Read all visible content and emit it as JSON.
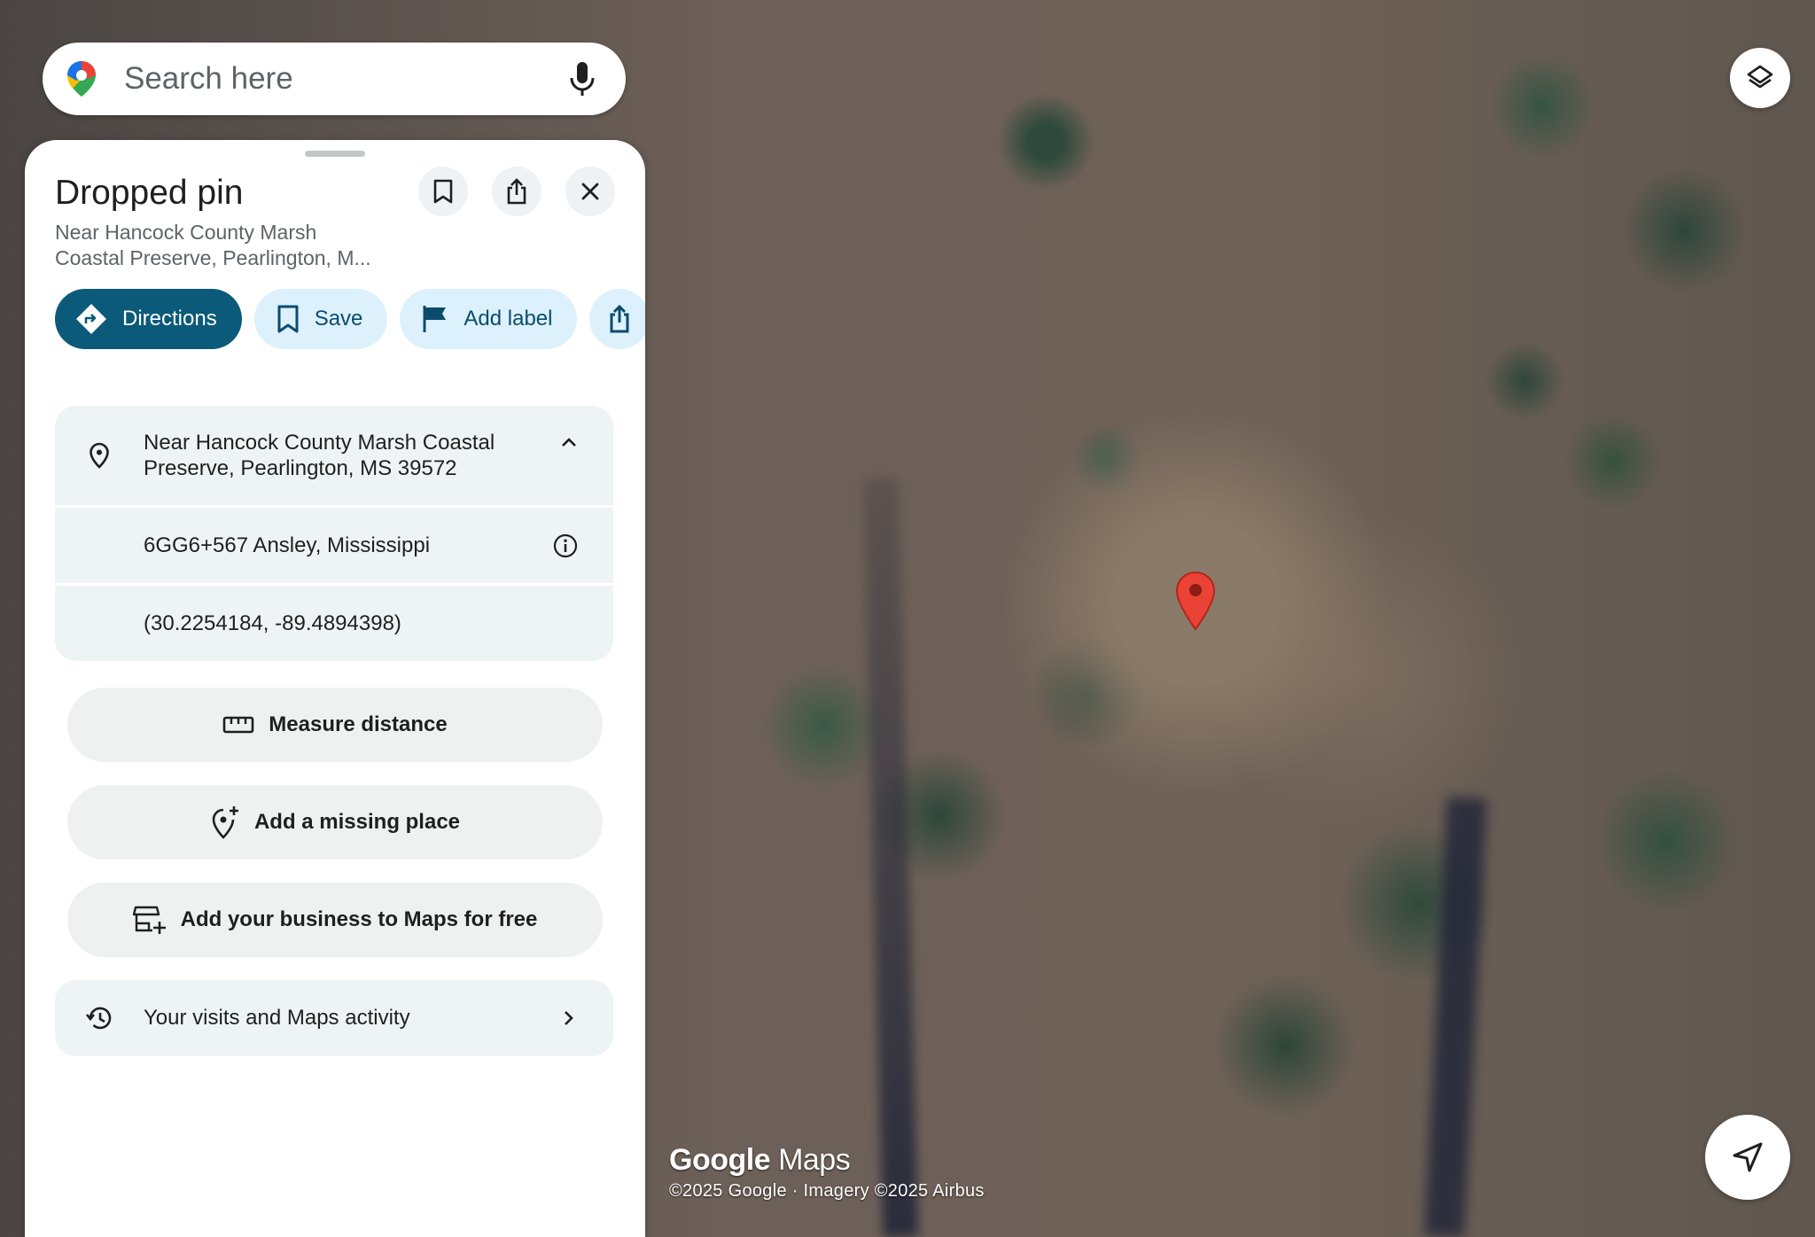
{
  "search": {
    "placeholder": "Search here"
  },
  "place": {
    "title": "Dropped pin",
    "subtitle_line1": "Near Hancock County Marsh",
    "subtitle_line2": "Coastal Preserve, Pearlington, M..."
  },
  "chips": {
    "directions": "Directions",
    "save": "Save",
    "add_label": "Add label"
  },
  "details": {
    "address_line1": "Near Hancock County Marsh Coastal",
    "address_line2": "Preserve, Pearlington, MS 39572",
    "plus_code": "6GG6+567 Ansley, Mississippi",
    "coordinates": "(30.2254184, -89.4894398)"
  },
  "actions": {
    "measure": "Measure distance",
    "missing_place": "Add a missing place",
    "business": "Add your business to Maps for free"
  },
  "visits": {
    "label": "Your visits and Maps activity"
  },
  "attribution": {
    "logo_google": "Google",
    "logo_maps": "Maps",
    "copyright": "©2025 Google · Imagery ©2025 Airbus"
  },
  "colors": {
    "primary_chip": "#0b5a7a",
    "chip_bg": "#dcf1fb",
    "pin_red": "#ea4335"
  }
}
